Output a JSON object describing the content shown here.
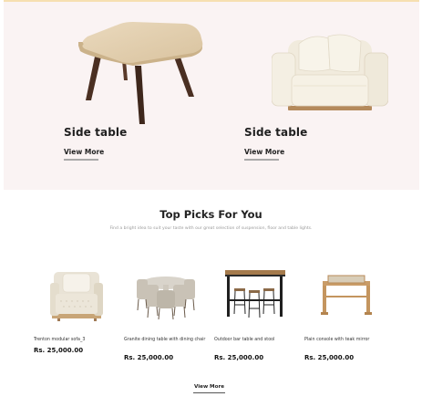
{
  "hero": {
    "cards": [
      {
        "title": "Side table",
        "link": "View More"
      },
      {
        "title": "Side table",
        "link": "View More"
      }
    ]
  },
  "picks": {
    "title": "Top Picks For You",
    "subtitle": "Find a bright idea to suit your taste with our great selection of suspension, floor and table lights.",
    "products": [
      {
        "name": "Trenton modular sofa_3",
        "price": "Rs. 25,000.00"
      },
      {
        "name": "Granite dining table with dining chair",
        "price": "Rs. 25,000.00"
      },
      {
        "name": "Outdoor bar table and stool",
        "price": "Rs. 25,000.00"
      },
      {
        "name": "Plain console with teak mirror",
        "price": "Rs. 25,000.00"
      }
    ],
    "more": "View More"
  }
}
